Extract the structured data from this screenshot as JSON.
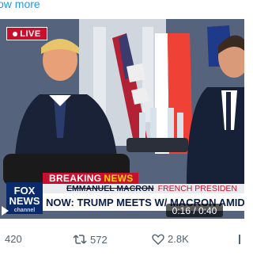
{
  "post": {
    "show_more_label": "ow more"
  },
  "video": {
    "live_label": "LIVE",
    "breaking_label": "BREAKING",
    "news_label": "NEWS",
    "name_label": "EMMANUEL MACRON",
    "role_label": "FRENCH PRESIDEN",
    "headline": "NOW: TRUMP MEETS W/ MACRON AMID IRAN DEAL MOM",
    "logo_line1": "FOX",
    "logo_line2": "NEWS",
    "logo_line3": "channel",
    "timestamp": "0:16 / 0:40",
    "brand_red": "#c8102e",
    "brand_navy": "#0a2a6b"
  },
  "actions": {
    "replies": "420",
    "reposts": "572",
    "likes": "2.8K"
  }
}
